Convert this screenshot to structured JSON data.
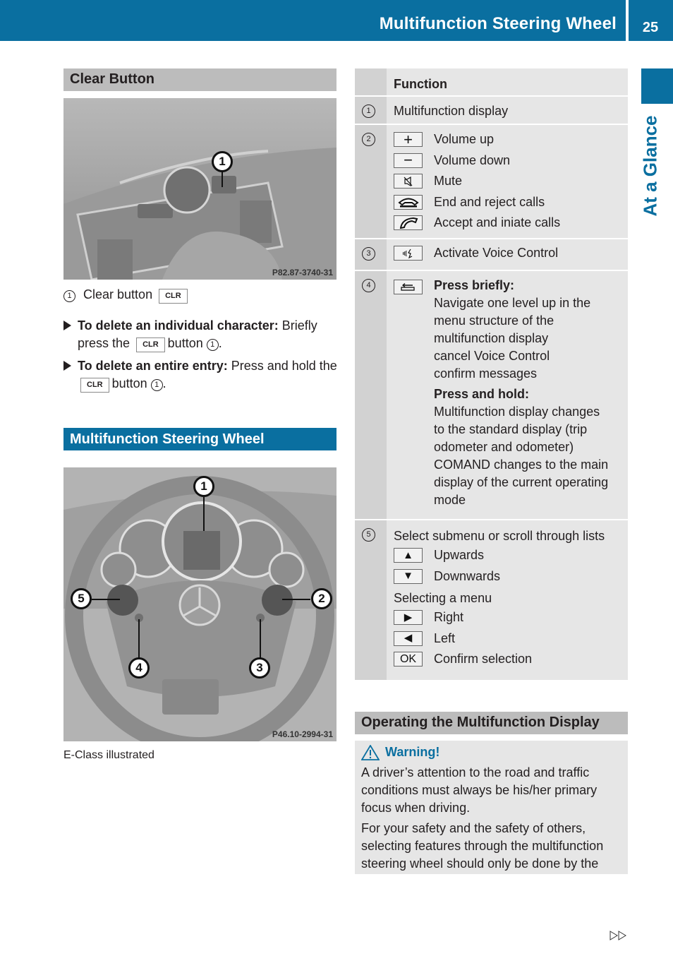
{
  "header": {
    "title": "Multifunction Steering Wheel",
    "page_number": "25"
  },
  "side_tab": {
    "label": "At a Glance"
  },
  "colors": {
    "brand_blue": "#0a6fa0",
    "section_gray": "#bcbcbc",
    "table_bg": "#e6e6e6",
    "table_num_bg": "#d2d2d2"
  },
  "clear_button": {
    "heading": "Clear Button",
    "image_code": "P82.87-3740-31",
    "callout": "1",
    "legend": {
      "num": "1",
      "text": "Clear button",
      "key": "CLR"
    },
    "bullets": [
      {
        "bold": "To delete an individual character:",
        "text1": " Briefly press the",
        "key": "CLR",
        "text2": "button",
        "num": "1",
        "end": "."
      },
      {
        "bold": "To delete an entire entry:",
        "text1": " Press and hold the",
        "key": "CLR",
        "text2": "button",
        "num": "1",
        "end": "."
      }
    ]
  },
  "steering_wheel": {
    "heading": "Multifunction Steering Wheel",
    "image_code": "P46.10-2994-31",
    "callouts": [
      "1",
      "2",
      "3",
      "4",
      "5"
    ],
    "caption": "E-Class illustrated"
  },
  "function_table": {
    "header": "Function",
    "rows": [
      {
        "num": "1",
        "text": "Multifunction display"
      },
      {
        "num": "2",
        "items": [
          {
            "icon": "plus-icon",
            "glyph": "+",
            "label": "Volume up"
          },
          {
            "icon": "minus-icon",
            "glyph": "−",
            "label": "Volume down"
          },
          {
            "icon": "mute-icon",
            "glyph": "",
            "label": "Mute"
          },
          {
            "icon": "end-call-icon",
            "glyph": "",
            "label": "End and reject calls"
          },
          {
            "icon": "accept-call-icon",
            "glyph": "",
            "label": "Accept and iniate calls"
          }
        ]
      },
      {
        "num": "3",
        "items": [
          {
            "icon": "voice-control-icon",
            "glyph": "",
            "label": "Activate Voice Control"
          }
        ]
      },
      {
        "num": "4",
        "icon": "back-icon",
        "brief_title": "Press briefly:",
        "brief_lines": [
          "Navigate one level up in the",
          "menu structure of the",
          "multifunction display",
          "cancel Voice Control",
          "confirm messages"
        ],
        "hold_title": "Press and hold:",
        "hold_lines": [
          "Multifunction display changes",
          "to the standard display (trip",
          "odometer and odometer)",
          "COMAND changes to the main",
          "display of the current operating",
          "mode"
        ]
      },
      {
        "num": "5",
        "intro": "Select submenu or scroll through lists",
        "scroll_items": [
          {
            "icon": "arrow-up-icon",
            "glyph": "▲",
            "label": "Upwards"
          },
          {
            "icon": "arrow-down-icon",
            "glyph": "▼",
            "label": "Downwards"
          }
        ],
        "menu_intro": "Selecting a menu",
        "menu_items": [
          {
            "icon": "arrow-right-icon",
            "glyph": "▶",
            "label": "Right"
          },
          {
            "icon": "arrow-left-icon",
            "glyph": "◀",
            "label": "Left"
          },
          {
            "icon": "ok-icon",
            "glyph": "OK",
            "label": "Confirm selection"
          }
        ]
      }
    ]
  },
  "operating_display": {
    "heading": "Operating the Multifunction Display",
    "warning_title": "Warning!",
    "paragraphs": [
      "A driver’s attention to the road and traffic conditions must always be his/her primary focus when driving.",
      "For your safety and the safety of others, selecting features through the multifunction steering wheel should only be done by the"
    ]
  },
  "footer": {
    "continue_icon": "continue-arrows-icon"
  }
}
